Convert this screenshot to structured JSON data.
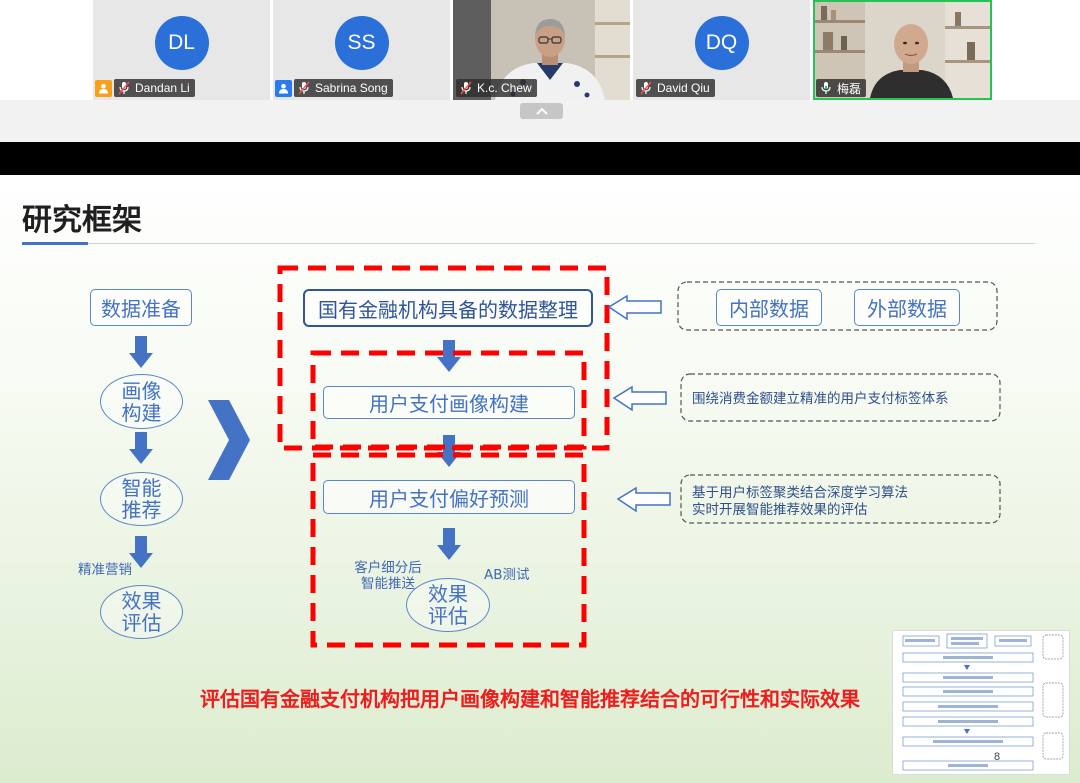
{
  "app": {
    "collapse_button_icon": "chevron-up-icon"
  },
  "participants": [
    {
      "initials": "DL",
      "name": "Dandan Li",
      "badge_icon": "host-icon",
      "badge_color": "#f7a01c",
      "mic": "muted",
      "video": "off",
      "avatar_color": "#2b6fd8"
    },
    {
      "initials": "SS",
      "name": "Sabrina Song",
      "badge_icon": "cohost-icon",
      "badge_color": "#2b7bf0",
      "mic": "muted",
      "video": "off",
      "avatar_color": "#2b6fd8"
    },
    {
      "name": "K.c. Chew",
      "mic": "muted",
      "video": "on"
    },
    {
      "initials": "DQ",
      "name": "David Qiu",
      "mic": "muted",
      "video": "off",
      "avatar_color": "#2b6fd8"
    },
    {
      "name": "梅磊",
      "mic": "on",
      "video": "on",
      "active_speaker": true,
      "highlight_color": "#23c552"
    }
  ],
  "slide": {
    "title": "研究框架",
    "left_flow": {
      "start": "数据准备",
      "step1": [
        "画像",
        "构建"
      ],
      "step2": [
        "智能",
        "推荐"
      ],
      "note": "精准营销",
      "step3": [
        "效果",
        "评估"
      ]
    },
    "center_flow": {
      "box1": "国有金融机构具备的数据整理",
      "box2": "用户支付画像构建",
      "box3": "用户支付偏好预测",
      "note_left": [
        "客户细分后",
        "智能推送"
      ],
      "note_right": "AB测试",
      "end": [
        "效果",
        "评估"
      ]
    },
    "right_notes": {
      "data_sources": [
        "内部数据",
        "外部数据"
      ],
      "note1": "围绕消费金额建立精准的用户支付标签体系",
      "note2": [
        "基于用户标签聚类结合深度学习算法",
        "实时开展智能推荐效果的评估"
      ]
    },
    "conclusion": "评估国有金融支付机构把用户画像构建和智能推荐结合的可行性和实际效果",
    "colors": {
      "accent_blue": "#4472c4",
      "dashed_highlight": "#ff0000",
      "conclusion_red": "#ee1c1c"
    }
  },
  "slide_preview": {
    "page_number": "8"
  }
}
